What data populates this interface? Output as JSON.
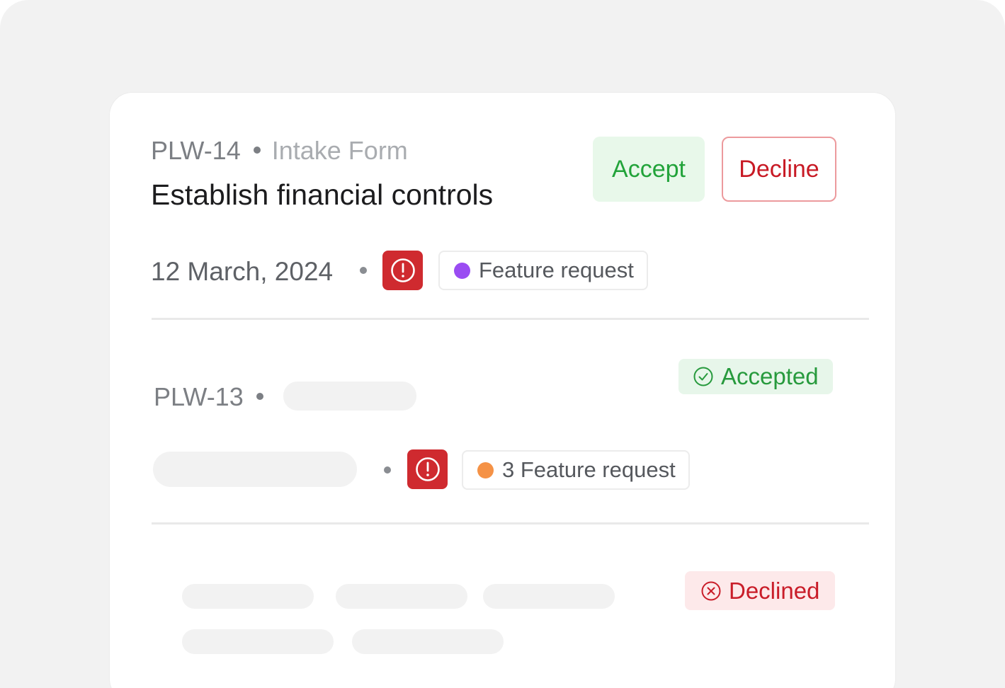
{
  "items": [
    {
      "id": "PLW-14",
      "source": "Intake Form",
      "title": "Establish financial controls",
      "date": "12 March, 2024",
      "tag": {
        "label": "Feature request",
        "color": "#9a4cf2"
      },
      "actions": {
        "accept_label": "Accept",
        "decline_label": "Decline"
      },
      "priority_icon": "alert-icon"
    },
    {
      "id": "PLW-13",
      "tag": {
        "label": "3 Feature request",
        "color": "#f59246"
      },
      "status": {
        "label": "Accepted",
        "icon": "check-circle-icon",
        "color": "#279a3d"
      },
      "priority_icon": "alert-icon"
    },
    {
      "status": {
        "label": "Declined",
        "icon": "x-circle-icon",
        "color": "#c91d29"
      }
    }
  ],
  "colors": {
    "accent_accept": "#22a33a",
    "accent_decline": "#c81a25",
    "alert_bg": "#cf2a2f"
  }
}
